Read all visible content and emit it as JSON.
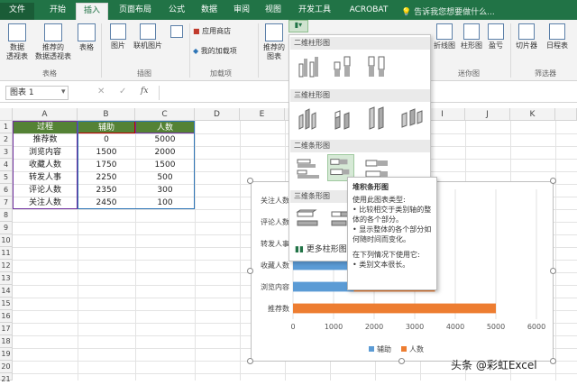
{
  "tabs": [
    "文件",
    "开始",
    "插入",
    "页面布局",
    "公式",
    "数据",
    "审阅",
    "视图",
    "开发工具",
    "ACROBAT"
  ],
  "active_tab": "插入",
  "tell_me": "告诉我您想要做什么...",
  "ribbon": {
    "pivot_table": "数据\n透视表",
    "recommended_pivot": "推荐的\n数据透视表",
    "table": "表格",
    "group_tables": "表格",
    "picture": "图片",
    "online_picture": "联机图片",
    "group_illustrations": "插图",
    "app_store": "应用商店",
    "my_addins": "我的加载项",
    "group_addins": "加载项",
    "recommended_charts": "推荐的\n图表",
    "line_sparkline": "折线图",
    "column_sparkline": "柱形图",
    "winloss": "盈亏",
    "group_sparklines": "迷你图",
    "slicer": "切片器",
    "timeline": "日程表",
    "group_filters": "筛选器"
  },
  "formula_bar": {
    "name_box": "图表 1",
    "fx": "fx"
  },
  "columns": [
    "A",
    "B",
    "C",
    "D",
    "E",
    "F",
    "G",
    "H",
    "I",
    "J",
    "K"
  ],
  "rows": [
    "1",
    "2",
    "3",
    "4",
    "5",
    "6",
    "7",
    "8",
    "9",
    "10",
    "11",
    "12",
    "13",
    "14",
    "15",
    "16",
    "17",
    "18",
    "19",
    "20",
    "21"
  ],
  "table": {
    "headers": [
      "过程",
      "辅助",
      "人数"
    ],
    "rows": [
      [
        "推荐数",
        "0",
        "5000"
      ],
      [
        "浏览内容",
        "1500",
        "2000"
      ],
      [
        "收藏人数",
        "1750",
        "1500"
      ],
      [
        "转发人事",
        "2250",
        "500"
      ],
      [
        "评论人数",
        "2350",
        "300"
      ],
      [
        "关注人数",
        "2450",
        "100"
      ]
    ]
  },
  "dropdown": {
    "sec_2d_column": "二维柱形图",
    "sec_3d_column": "三维柱形图",
    "sec_2d_bar": "二维条形图",
    "sec_3d_bar": "三维条形图",
    "more": "更多柱形图"
  },
  "tooltip": {
    "title": "堆积条形图",
    "line1": "使用此图表类型:",
    "line2": "• 比较相交于类别轴的整体的各个部分。",
    "line3": "• 显示整体的各个部分如何随时间而变化。",
    "line4": "在下列情况下使用它:",
    "line5": "• 类别文本很长。"
  },
  "chart_data": {
    "type": "bar",
    "stacked": true,
    "categories": [
      "推荐数",
      "浏览内容",
      "收藏人数",
      "转发人事",
      "评论人数",
      "关注人数"
    ],
    "series": [
      {
        "name": "辅助",
        "values": [
          0,
          1500,
          1750,
          2250,
          2350,
          2450
        ],
        "color": "#5b9bd5"
      },
      {
        "name": "人数",
        "values": [
          5000,
          2000,
          1500,
          500,
          300,
          100
        ],
        "color": "#ed7d31"
      }
    ],
    "xlim": [
      0,
      6000
    ],
    "xticks": [
      0,
      1000,
      2000,
      3000,
      4000,
      5000,
      6000
    ],
    "legend": "bottom"
  },
  "colors": {
    "brand": "#217346",
    "header_fill": "#548235",
    "bar_blue": "#5b9bd5",
    "bar_orange": "#ed7d31"
  },
  "watermark": "头条 @彩虹Excel"
}
